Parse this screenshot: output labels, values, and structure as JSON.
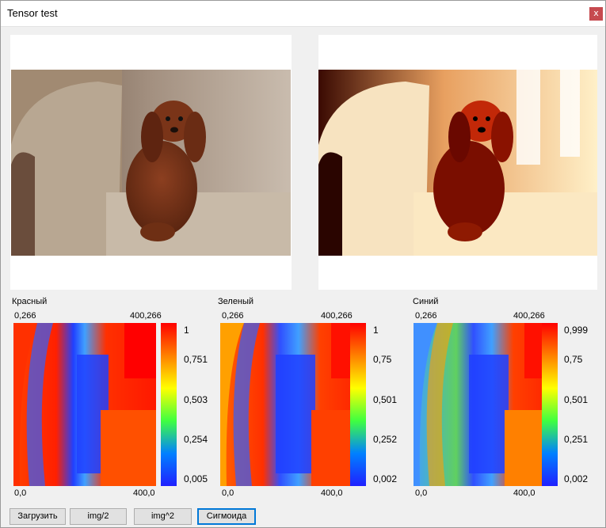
{
  "window": {
    "title": "Tensor test",
    "close_label": "x"
  },
  "images": {
    "original": {
      "description": "dog-on-sofa-photo"
    },
    "processed": {
      "description": "sigmoid-processed-photo"
    }
  },
  "channels": [
    {
      "label": "Красный",
      "top_left": "0,266",
      "top_right": "400,266",
      "bottom_left": "0,0",
      "bottom_right": "400,0",
      "ticks": [
        "1",
        "0,751",
        "0,503",
        "0,254",
        "0,005"
      ]
    },
    {
      "label": "Зеленый",
      "top_left": "0,266",
      "top_right": "400,266",
      "bottom_left": "0,0",
      "bottom_right": "400,0",
      "ticks": [
        "1",
        "0,75",
        "0,501",
        "0,252",
        "0,002"
      ]
    },
    {
      "label": "Синий",
      "top_left": "0,266",
      "top_right": "400,266",
      "bottom_left": "0,0",
      "bottom_right": "400,0",
      "ticks": [
        "0,999",
        "0,75",
        "0,501",
        "0,251",
        "0,002"
      ]
    }
  ],
  "buttons": {
    "load": "Загрузить",
    "half": "img/2",
    "square": "img^2",
    "sigmoid": "Сигмоида"
  },
  "colors": {
    "colormap": [
      "#ff0000",
      "#ff8000",
      "#ffff00",
      "#40ff40",
      "#0080ff",
      "#2020ff"
    ],
    "focus": "#0078d7",
    "close": "#c64a4f"
  }
}
